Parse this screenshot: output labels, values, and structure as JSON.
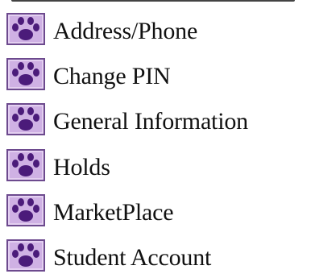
{
  "menu": {
    "items": [
      {
        "label": "Address/Phone",
        "icon": "paw-icon"
      },
      {
        "label": "Change PIN",
        "icon": "paw-icon"
      },
      {
        "label": "General Information",
        "icon": "paw-icon"
      },
      {
        "label": "Holds",
        "icon": "paw-icon"
      },
      {
        "label": "MarketPlace",
        "icon": "paw-icon"
      },
      {
        "label": "Student Account",
        "icon": "paw-icon"
      }
    ]
  },
  "colors": {
    "icon_background": "#c9a6e0",
    "paw": "#4b1b7a",
    "text": "#111111"
  }
}
